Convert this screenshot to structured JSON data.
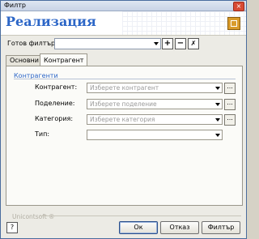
{
  "window": {
    "title": "Филтр"
  },
  "header": {
    "title": "Реализация"
  },
  "ready_filter": {
    "label": "Готов филтър:",
    "value": ""
  },
  "tabs": [
    {
      "label": "Основни",
      "active": false
    },
    {
      "label": "Контрагент",
      "active": true
    }
  ],
  "group": {
    "title": "Контрагенти"
  },
  "fields": [
    {
      "label": "Контрагент:",
      "placeholder": "Изберете контрагент",
      "has_browse": true
    },
    {
      "label": "Поделение:",
      "placeholder": "Изберете поделение",
      "has_browse": true
    },
    {
      "label": "Категория:",
      "placeholder": "Изберете категория",
      "has_browse": true
    },
    {
      "label": "Тип:",
      "placeholder": "",
      "has_browse": false
    }
  ],
  "browse_label": "...",
  "footer": {
    "brand": "Unicontsoft ®",
    "ok": "Ок",
    "cancel": "Отказ",
    "filter": "Филтър"
  },
  "colors": {
    "accent": "#2c66c7",
    "header_icon": "#d99b2b"
  }
}
